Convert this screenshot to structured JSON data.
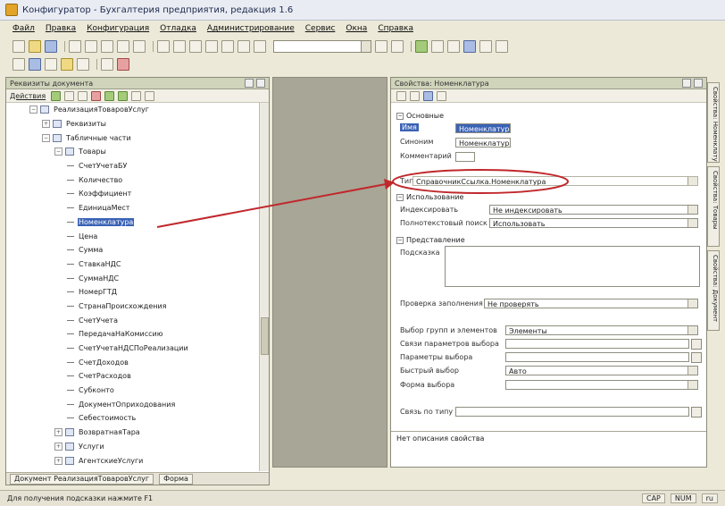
{
  "window": {
    "title": "Конфигуратор - Бухгалтерия предприятия, редакция 1.6"
  },
  "menu": [
    "Файл",
    "Правка",
    "Конфигурация",
    "Отладка",
    "Администрирование",
    "Сервис",
    "Окна",
    "Справка"
  ],
  "left_panel": {
    "title": "Реквизиты документа",
    "toolbar_label": "Действия",
    "tree": [
      {
        "label": "РеализацияТоваровУслуг",
        "depth": 0,
        "kind": "node",
        "exp": "−"
      },
      {
        "label": "Реквизиты",
        "depth": 1,
        "kind": "node",
        "exp": "+"
      },
      {
        "label": "Табличные части",
        "depth": 1,
        "kind": "node",
        "exp": "−"
      },
      {
        "label": "Товары",
        "depth": 2,
        "kind": "node",
        "exp": "−"
      },
      {
        "label": "СчетУчетаБУ",
        "depth": 3,
        "kind": "leaf"
      },
      {
        "label": "Количество",
        "depth": 3,
        "kind": "leaf"
      },
      {
        "label": "Коэффициент",
        "depth": 3,
        "kind": "leaf"
      },
      {
        "label": "ЕдиницаМест",
        "depth": 3,
        "kind": "leaf"
      },
      {
        "label": "Номенклатура",
        "depth": 3,
        "kind": "leaf",
        "selected": true
      },
      {
        "label": "Цена",
        "depth": 3,
        "kind": "leaf"
      },
      {
        "label": "Сумма",
        "depth": 3,
        "kind": "leaf"
      },
      {
        "label": "СтавкаНДС",
        "depth": 3,
        "kind": "leaf"
      },
      {
        "label": "СуммаНДС",
        "depth": 3,
        "kind": "leaf"
      },
      {
        "label": "НомерГТД",
        "depth": 3,
        "kind": "leaf"
      },
      {
        "label": "СтранаПроисхождения",
        "depth": 3,
        "kind": "leaf"
      },
      {
        "label": "СчетУчета",
        "depth": 3,
        "kind": "leaf"
      },
      {
        "label": "ПередачаНаКомиссию",
        "depth": 3,
        "kind": "leaf"
      },
      {
        "label": "СчетУчетаНДСПоРеализации",
        "depth": 3,
        "kind": "leaf"
      },
      {
        "label": "СчетДоходов",
        "depth": 3,
        "kind": "leaf"
      },
      {
        "label": "СчетРасходов",
        "depth": 3,
        "kind": "leaf"
      },
      {
        "label": "Субконто",
        "depth": 3,
        "kind": "leaf"
      },
      {
        "label": "ДокументОприходования",
        "depth": 3,
        "kind": "leaf"
      },
      {
        "label": "Себестоимость",
        "depth": 3,
        "kind": "leaf"
      },
      {
        "label": "ВозвратнаяТара",
        "depth": 2,
        "kind": "node",
        "exp": "+"
      },
      {
        "label": "Услуги",
        "depth": 2,
        "kind": "node",
        "exp": "+"
      },
      {
        "label": "АгентскиеУслуги",
        "depth": 2,
        "kind": "node",
        "exp": "+"
      }
    ],
    "bottom_tabs": [
      "Документ РеализацияТоваровУслуг",
      "Форма"
    ]
  },
  "right_panel": {
    "title": "Свойства: Номенклатура",
    "sections": {
      "main": "Основные",
      "usage": "Использование",
      "presentation": "Представление"
    },
    "props": {
      "name_label": "Имя",
      "name_value": "Номенклатура",
      "synonym_label": "Синоним",
      "synonym_value": "Номенклатура",
      "comment_label": "Комментарий",
      "type_label": "Тип",
      "type_value": "СправочникСсылка.Номенклатура",
      "indexing_label": "Индексировать",
      "indexing_value": "Не индексировать",
      "fulltext_label": "Полнотекстовый поиск",
      "fulltext_value": "Использовать",
      "hint_label": "Подсказка",
      "fillcheck_label": "Проверка заполнения",
      "fillcheck_value": "Не проверять",
      "choicegroup_label": "Выбор групп и элементов",
      "choicegroup_value": "Элементы",
      "choiceparams_label": "Связи параметров выбора",
      "choicelinks_label": "Параметры выбора",
      "quickchoice_label": "Быстрый выбор",
      "quickchoice_value": "Авто",
      "choiceform_label": "Форма выбора",
      "linkbytype_label": "Связь по типу"
    },
    "description": "Нет описания свойства"
  },
  "side_tabs": [
    "Свойства: Номенклатура",
    "Свойства: Товары",
    "Свойства: Документ"
  ],
  "statusbar": {
    "left": "Для получения подсказки нажмите F1",
    "indicators": [
      "CAP",
      "NUM",
      "ru"
    ]
  },
  "annotation": {
    "color": "#c0282c"
  }
}
